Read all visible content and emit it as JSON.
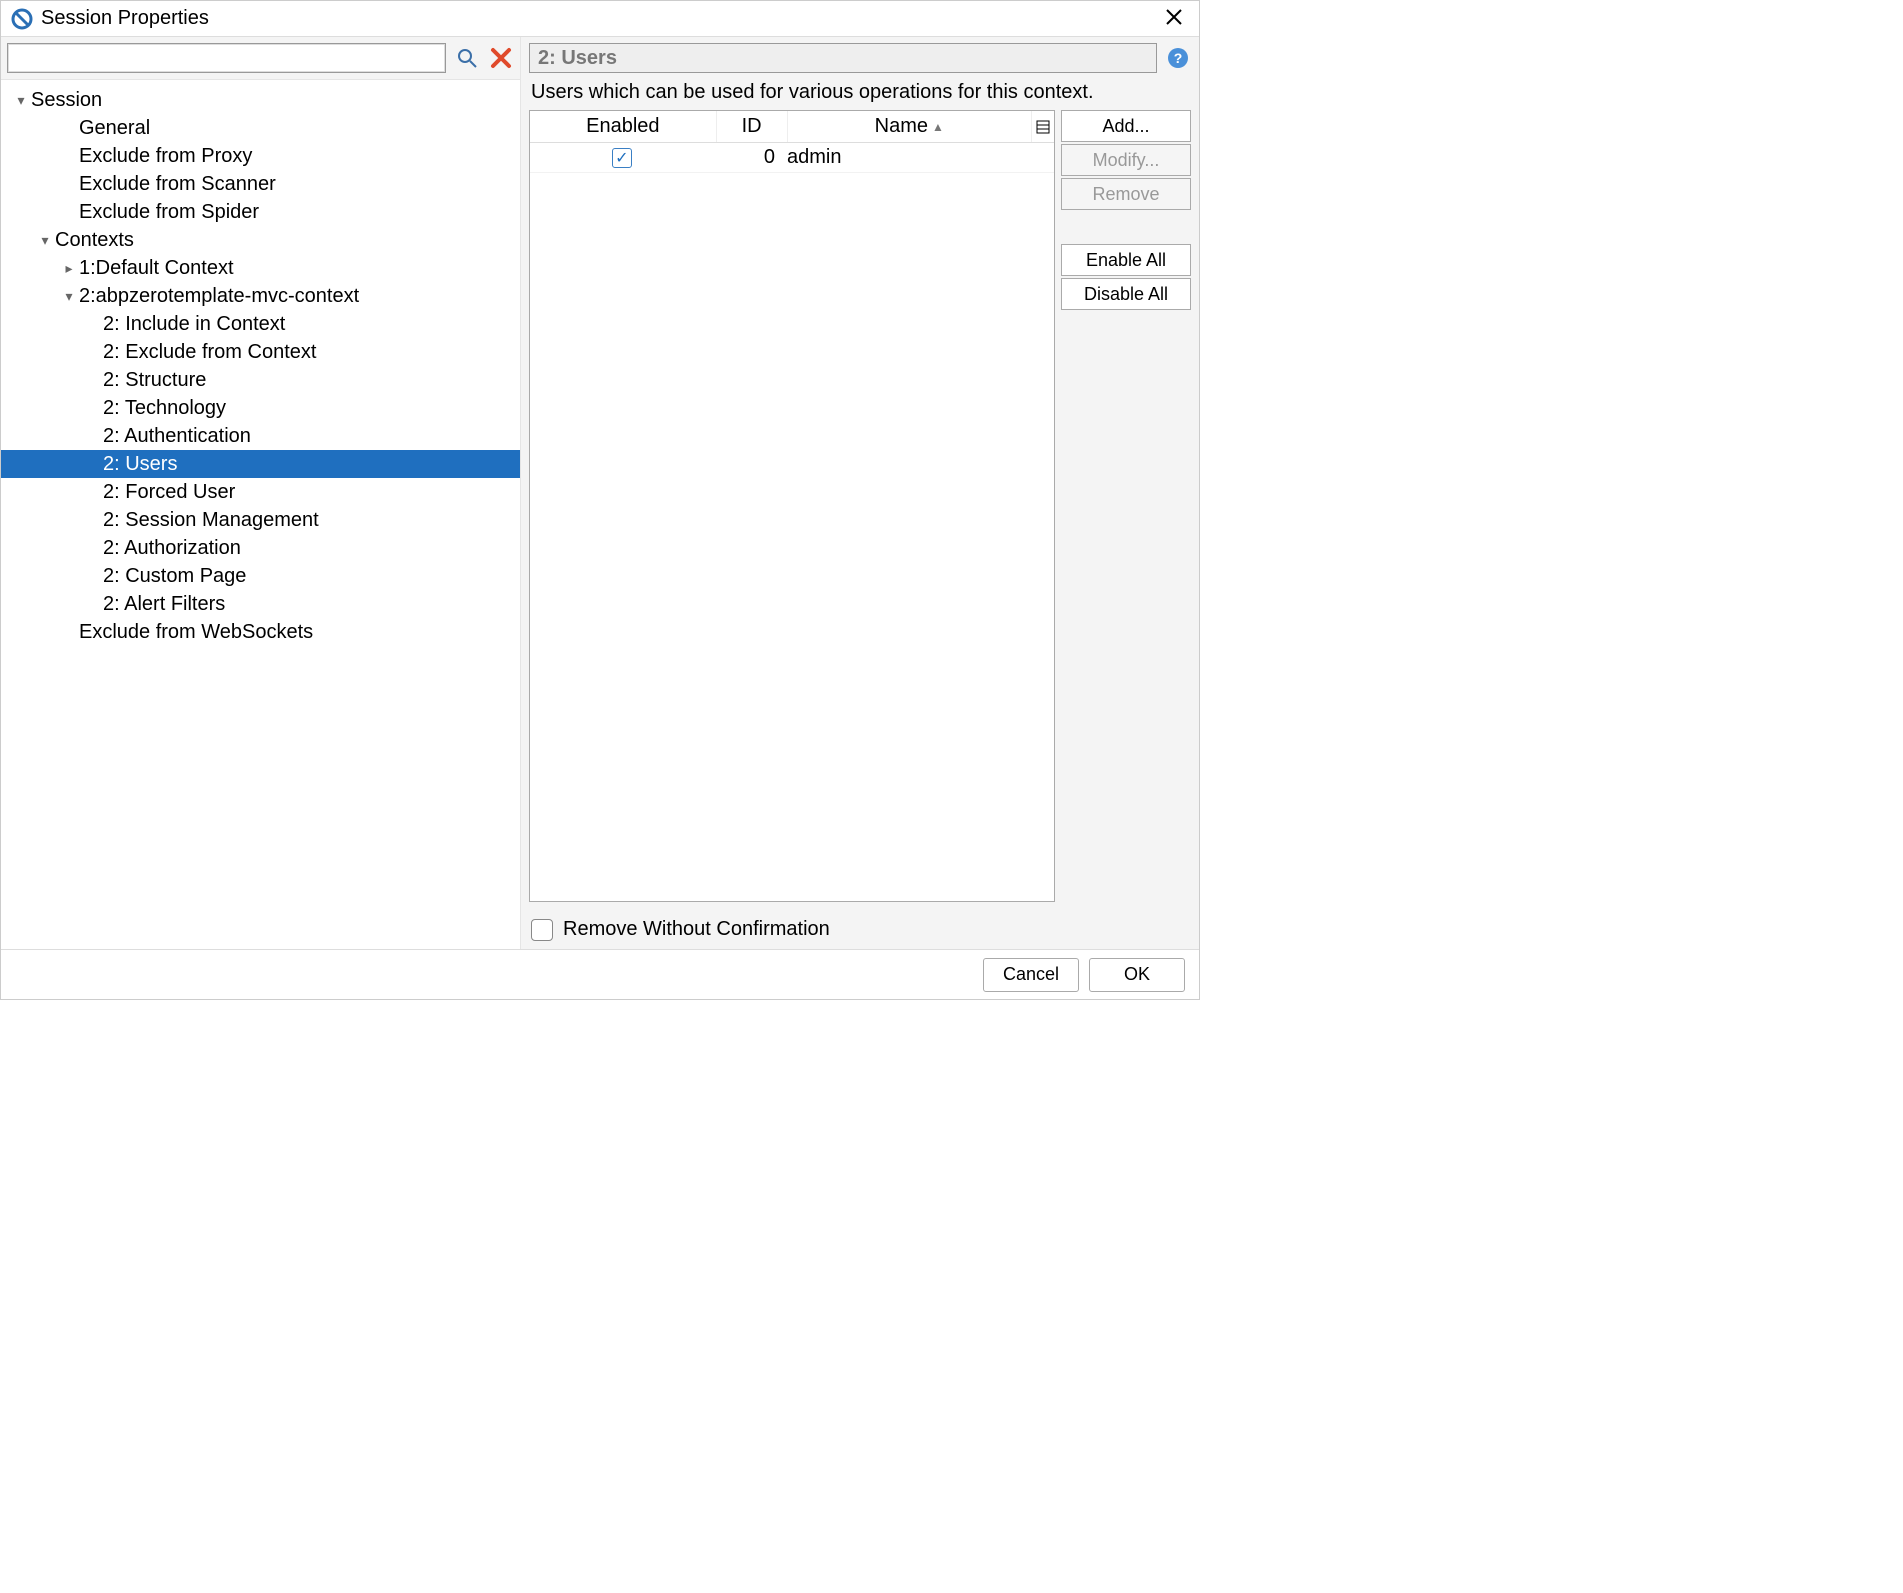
{
  "window": {
    "title": "Session Properties"
  },
  "search": {
    "value": ""
  },
  "tree": {
    "items": [
      {
        "label": "Session",
        "depth": 0,
        "arrow": "down",
        "selected": false
      },
      {
        "label": "General",
        "depth": 2,
        "arrow": "none",
        "selected": false
      },
      {
        "label": "Exclude from Proxy",
        "depth": 2,
        "arrow": "none",
        "selected": false
      },
      {
        "label": "Exclude from Scanner",
        "depth": 2,
        "arrow": "none",
        "selected": false
      },
      {
        "label": "Exclude from Spider",
        "depth": 2,
        "arrow": "none",
        "selected": false
      },
      {
        "label": "Contexts",
        "depth": 1,
        "arrow": "down",
        "selected": false
      },
      {
        "label": "1:Default Context",
        "depth": 2,
        "arrow": "right",
        "selected": false
      },
      {
        "label": "2:abpzerotemplate-mvc-context",
        "depth": 2,
        "arrow": "down",
        "selected": false
      },
      {
        "label": "2: Include in Context",
        "depth": 3,
        "arrow": "none",
        "selected": false
      },
      {
        "label": "2: Exclude from Context",
        "depth": 3,
        "arrow": "none",
        "selected": false
      },
      {
        "label": "2: Structure",
        "depth": 3,
        "arrow": "none",
        "selected": false
      },
      {
        "label": "2: Technology",
        "depth": 3,
        "arrow": "none",
        "selected": false
      },
      {
        "label": "2: Authentication",
        "depth": 3,
        "arrow": "none",
        "selected": false
      },
      {
        "label": "2: Users",
        "depth": 3,
        "arrow": "none",
        "selected": true
      },
      {
        "label": "2: Forced User",
        "depth": 3,
        "arrow": "none",
        "selected": false
      },
      {
        "label": "2: Session Management",
        "depth": 3,
        "arrow": "none",
        "selected": false
      },
      {
        "label": "2: Authorization",
        "depth": 3,
        "arrow": "none",
        "selected": false
      },
      {
        "label": "2: Custom Page",
        "depth": 3,
        "arrow": "none",
        "selected": false
      },
      {
        "label": "2: Alert Filters",
        "depth": 3,
        "arrow": "none",
        "selected": false
      },
      {
        "label": "Exclude from WebSockets",
        "depth": 2,
        "arrow": "none",
        "selected": false
      }
    ]
  },
  "panel": {
    "title": "2: Users",
    "description": "Users which can be used for various operations for this context.",
    "columns": {
      "enabled": "Enabled",
      "id": "ID",
      "name": "Name"
    },
    "rows": [
      {
        "enabled": true,
        "id": "0",
        "name": "admin"
      }
    ],
    "buttons": {
      "add": "Add...",
      "modify": "Modify...",
      "remove": "Remove",
      "enable_all": "Enable All",
      "disable_all": "Disable All"
    },
    "remove_without_confirmation": "Remove Without Confirmation"
  },
  "footer": {
    "cancel": "Cancel",
    "ok": "OK"
  }
}
